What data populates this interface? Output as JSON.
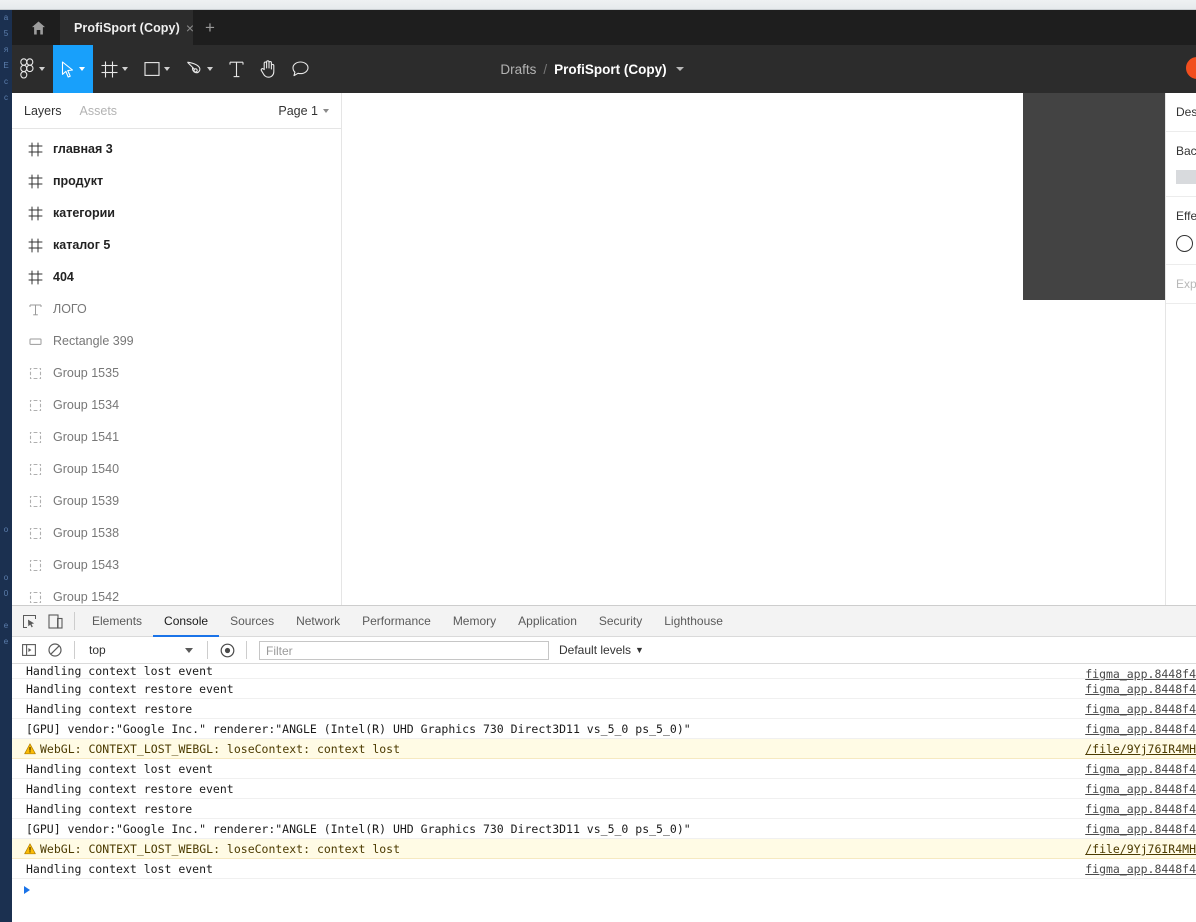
{
  "browser": {
    "home_icon": "home-icon",
    "tab_title": "ProfiSport (Copy)",
    "tab_close": "×",
    "new_tab": "+"
  },
  "figma": {
    "toolbar": [
      {
        "name": "figma-logo",
        "icon": "figma-logo-icon",
        "has_caret": true,
        "active": false
      },
      {
        "name": "move-tool",
        "icon": "cursor-icon",
        "has_caret": true,
        "active": true
      },
      {
        "name": "frame-tool",
        "icon": "frame-icon",
        "has_caret": true,
        "active": false
      },
      {
        "name": "shape-tool",
        "icon": "rectangle-icon",
        "has_caret": true,
        "active": false
      },
      {
        "name": "pen-tool",
        "icon": "pen-icon",
        "has_caret": true,
        "active": false
      },
      {
        "name": "text-tool",
        "icon": "text-icon",
        "has_caret": false,
        "active": false
      },
      {
        "name": "hand-tool",
        "icon": "hand-icon",
        "has_caret": false,
        "active": false
      },
      {
        "name": "comment-tool",
        "icon": "comment-icon",
        "has_caret": false,
        "active": false
      }
    ],
    "breadcrumb": {
      "project": "Drafts",
      "separator": "/",
      "file": "ProfiSport (Copy)"
    },
    "avatar_color": "#f24e1e",
    "left_panel": {
      "tab_layers": "Layers",
      "tab_assets": "Assets",
      "page": "Page 1",
      "layers": [
        {
          "name": "главная 3",
          "type": "frame"
        },
        {
          "name": "продукт",
          "type": "frame"
        },
        {
          "name": "категории",
          "type": "frame"
        },
        {
          "name": "каталог 5",
          "type": "frame"
        },
        {
          "name": "404",
          "type": "frame"
        },
        {
          "name": "ЛОГО",
          "type": "text"
        },
        {
          "name": "Rectangle 399",
          "type": "rect"
        },
        {
          "name": "Group 1535",
          "type": "group"
        },
        {
          "name": "Group 1534",
          "type": "group"
        },
        {
          "name": "Group 1541",
          "type": "group"
        },
        {
          "name": "Group 1540",
          "type": "group"
        },
        {
          "name": "Group 1539",
          "type": "group"
        },
        {
          "name": "Group 1538",
          "type": "group"
        },
        {
          "name": "Group 1543",
          "type": "group"
        },
        {
          "name": "Group 1542",
          "type": "group"
        }
      ]
    },
    "right_panel": {
      "design": "Design",
      "background": "Background",
      "effects": "Effects",
      "export": "Export"
    },
    "canvas_rect_color": "#434343"
  },
  "devtools": {
    "tabs": [
      {
        "label": "Elements",
        "selected": false
      },
      {
        "label": "Console",
        "selected": true
      },
      {
        "label": "Sources",
        "selected": false
      },
      {
        "label": "Network",
        "selected": false
      },
      {
        "label": "Performance",
        "selected": false
      },
      {
        "label": "Memory",
        "selected": false
      },
      {
        "label": "Application",
        "selected": false
      },
      {
        "label": "Security",
        "selected": false
      },
      {
        "label": "Lighthouse",
        "selected": false
      }
    ],
    "filterbar": {
      "context": "top",
      "filter_placeholder": "Filter",
      "filter_value": "",
      "levels": "Default levels",
      "levels_caret": "▼"
    },
    "console_rows": [
      {
        "msg": "Handling context lost event",
        "src": "figma_app.8448f4",
        "level": "log",
        "clipped": true
      },
      {
        "msg": "Handling context restore event",
        "src": "figma_app.8448f4",
        "level": "log"
      },
      {
        "msg": "Handling context restore",
        "src": "figma_app.8448f4",
        "level": "log"
      },
      {
        "msg": "[GPU] vendor:\"Google Inc.\" renderer:\"ANGLE (Intel(R) UHD Graphics 730 Direct3D11 vs_5_0 ps_5_0)\"",
        "src": "figma_app.8448f4",
        "level": "log"
      },
      {
        "msg": "WebGL: CONTEXT_LOST_WEBGL: loseContext: context lost",
        "src": "/file/9Yj76IR4MH",
        "level": "warning"
      },
      {
        "msg": "Handling context lost event",
        "src": "figma_app.8448f4",
        "level": "log"
      },
      {
        "msg": "Handling context restore event",
        "src": "figma_app.8448f4",
        "level": "log"
      },
      {
        "msg": "Handling context restore",
        "src": "figma_app.8448f4",
        "level": "log"
      },
      {
        "msg": "[GPU] vendor:\"Google Inc.\" renderer:\"ANGLE (Intel(R) UHD Graphics 730 Direct3D11 vs_5_0 ps_5_0)\"",
        "src": "figma_app.8448f4",
        "level": "log"
      },
      {
        "msg": "WebGL: CONTEXT_LOST_WEBGL: loseContext: context lost",
        "src": "/file/9Yj76IR4MH",
        "level": "warning"
      },
      {
        "msg": "Handling context lost event",
        "src": "figma_app.8448f4",
        "level": "log"
      }
    ]
  }
}
